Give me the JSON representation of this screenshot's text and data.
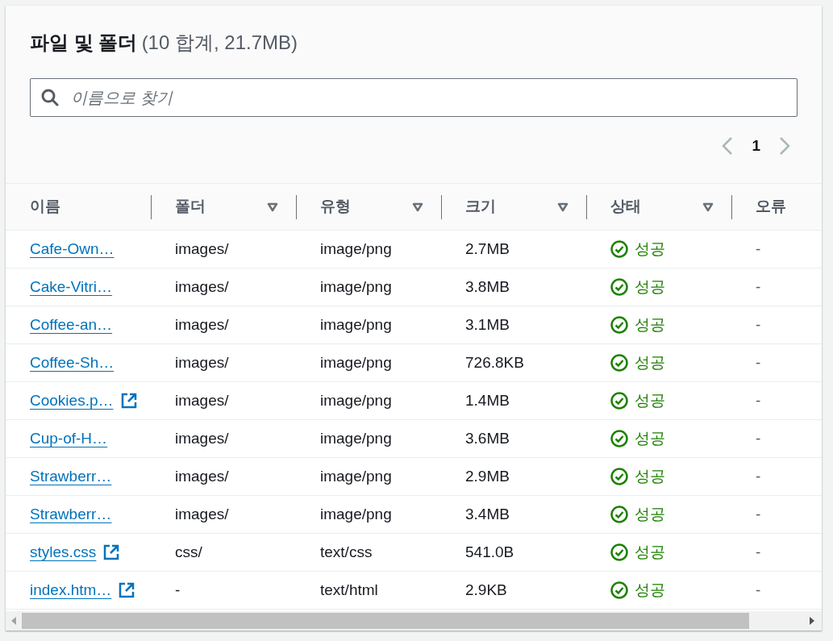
{
  "header": {
    "title": "파일 및 폴더",
    "count": "(10 합계, 21.7MB)"
  },
  "search": {
    "placeholder": "이름으로 찾기"
  },
  "pagination": {
    "pages": [
      {
        "label": "1",
        "selected": true
      }
    ],
    "prev_disabled": true,
    "next_disabled": true
  },
  "table": {
    "columns": [
      {
        "label": "이름",
        "sortable": false
      },
      {
        "label": "폴더",
        "sortable": true
      },
      {
        "label": "유형",
        "sortable": true
      },
      {
        "label": "크기",
        "sortable": true
      },
      {
        "label": "상태",
        "sortable": true
      },
      {
        "label": "오류",
        "sortable": false
      }
    ],
    "rows": [
      {
        "name": "Cafe-Own…",
        "external": false,
        "folder": "images/",
        "type": "image/png",
        "size": "2.7MB",
        "status": "성공",
        "kind": "success",
        "error": "-"
      },
      {
        "name": "Cake-Vitri…",
        "external": false,
        "folder": "images/",
        "type": "image/png",
        "size": "3.8MB",
        "status": "성공",
        "kind": "success",
        "error": "-"
      },
      {
        "name": "Coffee-an…",
        "external": false,
        "folder": "images/",
        "type": "image/png",
        "size": "3.1MB",
        "status": "성공",
        "kind": "success",
        "error": "-"
      },
      {
        "name": "Coffee-Sh…",
        "external": false,
        "folder": "images/",
        "type": "image/png",
        "size": "726.8KB",
        "status": "성공",
        "kind": "success",
        "error": "-"
      },
      {
        "name": "Cookies.p…",
        "external": true,
        "folder": "images/",
        "type": "image/png",
        "size": "1.4MB",
        "status": "성공",
        "kind": "success",
        "error": "-"
      },
      {
        "name": "Cup-of-H…",
        "external": false,
        "folder": "images/",
        "type": "image/png",
        "size": "3.6MB",
        "status": "성공",
        "kind": "success",
        "error": "-"
      },
      {
        "name": "Strawberr…",
        "external": false,
        "folder": "images/",
        "type": "image/png",
        "size": "2.9MB",
        "status": "성공",
        "kind": "success",
        "error": "-"
      },
      {
        "name": "Strawberr…",
        "external": false,
        "folder": "images/",
        "type": "image/png",
        "size": "3.4MB",
        "status": "성공",
        "kind": "success",
        "error": "-"
      },
      {
        "name": "styles.css",
        "external": true,
        "folder": "css/",
        "type": "text/css",
        "size": "541.0B",
        "status": "성공",
        "kind": "success",
        "error": "-"
      },
      {
        "name": "index.htm…",
        "external": true,
        "folder": "-",
        "type": "text/html",
        "size": "2.9KB",
        "status": "성공",
        "kind": "success",
        "error": "-"
      }
    ]
  }
}
